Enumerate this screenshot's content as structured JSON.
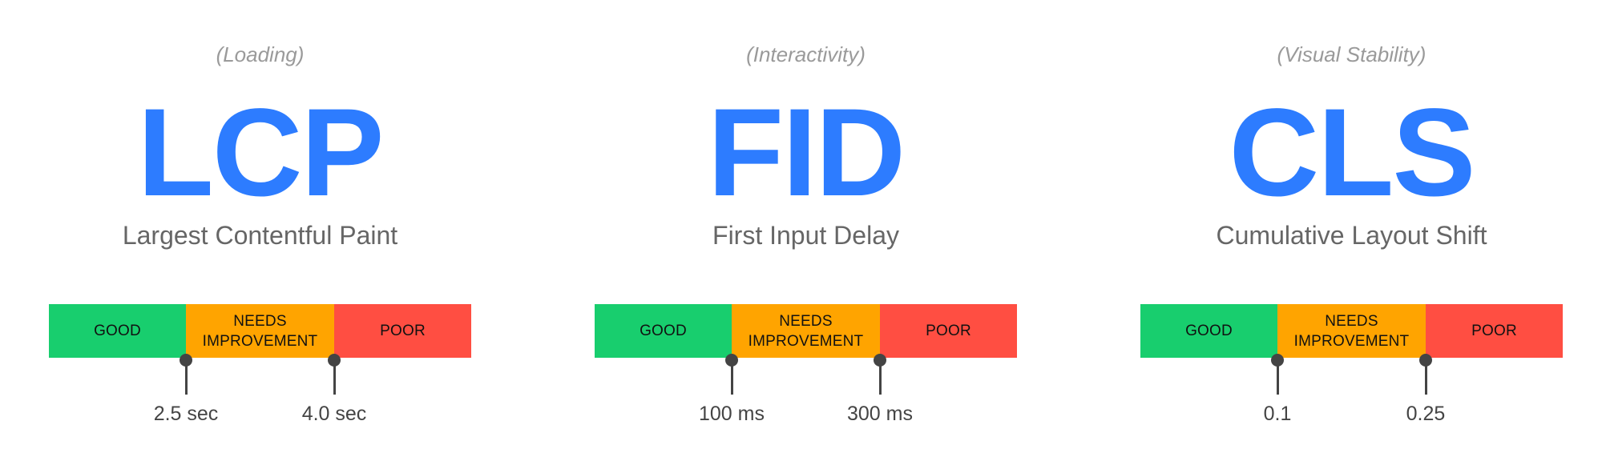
{
  "colors": {
    "accent_blue": "#2D7CFF",
    "good": "#18CE6E",
    "needs_improvement": "#FFA400",
    "poor": "#FF4E42",
    "marker": "#444444"
  },
  "metrics": [
    {
      "category": "(Loading)",
      "acronym": "LCP",
      "full_name": "Largest Contentful Paint",
      "segments": {
        "good": "GOOD",
        "needs_line1": "NEEDS",
        "needs_line2": "IMPROVEMENT",
        "poor": "POOR"
      },
      "thresholds": [
        "2.5 sec",
        "4.0 sec"
      ]
    },
    {
      "category": "(Interactivity)",
      "acronym": "FID",
      "full_name": "First Input Delay",
      "segments": {
        "good": "GOOD",
        "needs_line1": "NEEDS",
        "needs_line2": "IMPROVEMENT",
        "poor": "POOR"
      },
      "thresholds": [
        "100 ms",
        "300 ms"
      ]
    },
    {
      "category": "(Visual Stability)",
      "acronym": "CLS",
      "full_name": "Cumulative Layout Shift",
      "segments": {
        "good": "GOOD",
        "needs_line1": "NEEDS",
        "needs_line2": "IMPROVEMENT",
        "poor": "POOR"
      },
      "thresholds": [
        "0.1",
        "0.25"
      ]
    }
  ]
}
